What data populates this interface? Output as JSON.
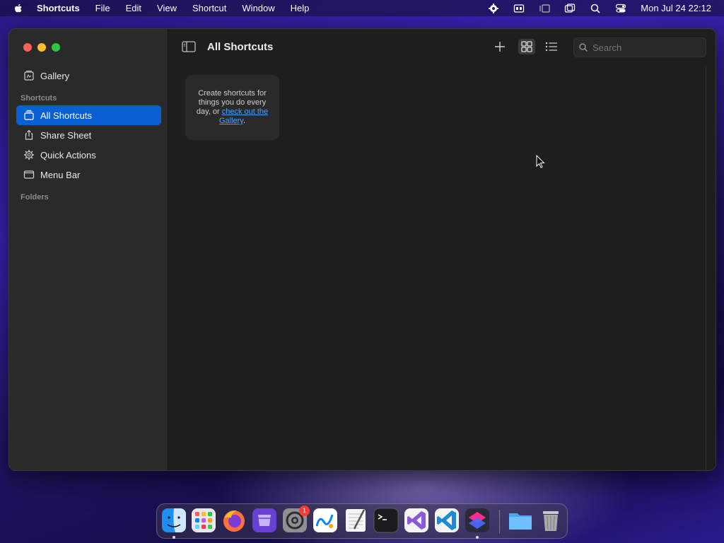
{
  "menubar": {
    "app_name": "Shortcuts",
    "items": [
      "File",
      "Edit",
      "View",
      "Shortcut",
      "Window",
      "Help"
    ],
    "status_icons": [
      "gear-status-icon",
      "keyboard-icon",
      "stage-manager-icon",
      "screen-mirroring-icon",
      "spotlight-search-icon",
      "control-center-icon"
    ],
    "clock": "Mon Jul 24  22:12"
  },
  "sidebar": {
    "gallery_label": "Gallery",
    "shortcuts_section": "Shortcuts",
    "items": [
      {
        "label": "All Shortcuts",
        "icon": "stack-icon",
        "selected": true
      },
      {
        "label": "Share Sheet",
        "icon": "share-icon",
        "selected": false
      },
      {
        "label": "Quick Actions",
        "icon": "gear-icon",
        "selected": false
      },
      {
        "label": "Menu Bar",
        "icon": "menu-bar-icon",
        "selected": false
      }
    ],
    "folders_section": "Folders"
  },
  "toolbar": {
    "title": "All Shortcuts",
    "search_placeholder": "Search"
  },
  "empty_state": {
    "text": "Create shortcuts for things you do every day, or ",
    "link_text": "check out the Gallery",
    "suffix": "."
  },
  "dock": {
    "apps": [
      "Finder",
      "Launchpad",
      "Firefox",
      "Simulator",
      "System Settings",
      "Freeform",
      "TextEdit",
      "Terminal",
      "Visual Studio",
      "Visual Studio Code",
      "Shortcuts",
      "Downloads",
      "Trash"
    ],
    "settings_badge": "1"
  },
  "colors": {
    "accent": "#0a5fd3",
    "link": "#4ea1ff",
    "window_bg": "#1e1e1e",
    "sidebar_bg": "#2a2a2a"
  }
}
